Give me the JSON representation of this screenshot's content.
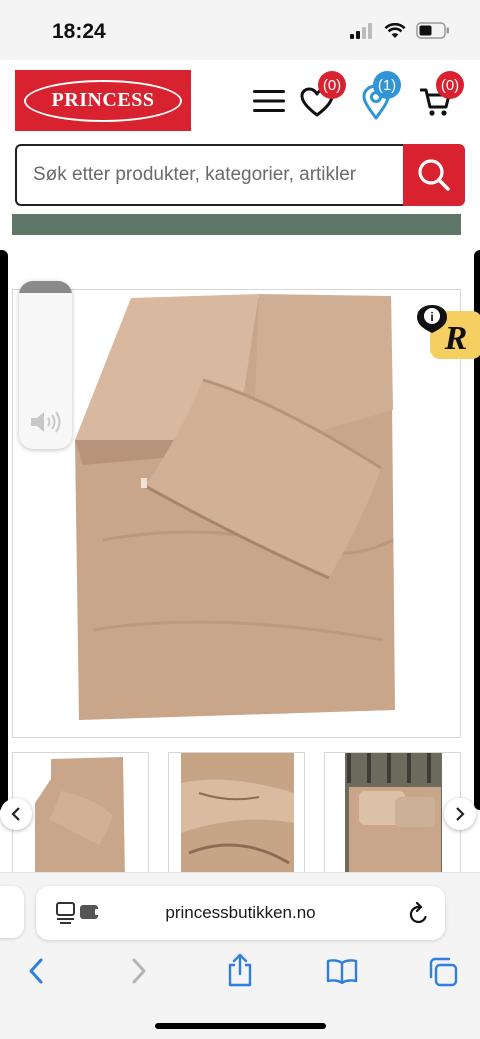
{
  "status_bar": {
    "time": "18:24"
  },
  "header": {
    "logo_text": "PRINCESS",
    "wishlist_count": "(0)",
    "stores_count": "(1)",
    "cart_count": "(0)"
  },
  "search": {
    "placeholder": "Søk etter produkter, kategorier, artikler"
  },
  "browser": {
    "url": "princessbutikken.no"
  },
  "colors": {
    "brand_red": "#d8222f",
    "badge_blue": "#2f95d6",
    "band_green": "#5f7766",
    "bedding_beige": "#c9a58a"
  },
  "icons": [
    "menu-icon",
    "heart-icon",
    "location-pin-icon",
    "cart-icon",
    "search-icon",
    "speaker-icon",
    "info-icon",
    "chevron-left-icon",
    "chevron-right-icon",
    "share-icon",
    "bookmarks-icon",
    "tabs-icon",
    "reload-icon"
  ]
}
